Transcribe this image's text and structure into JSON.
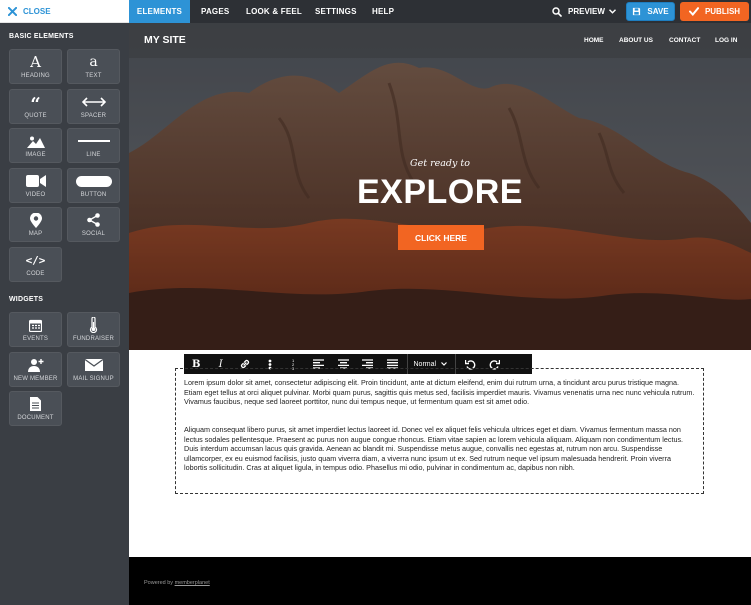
{
  "topbar": {
    "close_label": "CLOSE",
    "tabs": [
      {
        "label": "ELEMENTS"
      },
      {
        "label": "PAGES"
      },
      {
        "label": "LOOK & FEEL"
      },
      {
        "label": "SETTINGS"
      },
      {
        "label": "HELP"
      }
    ],
    "preview_label": "PREVIEW",
    "save_label": "SAVE",
    "publish_label": "PUBLISH"
  },
  "sidebar": {
    "basic_label": "BASIC ELEMENTS",
    "basic": [
      {
        "label": "HEADING",
        "icon": "heading-icon"
      },
      {
        "label": "TEXT",
        "icon": "text-icon"
      },
      {
        "label": "QUOTE",
        "icon": "quote-icon"
      },
      {
        "label": "SPACER",
        "icon": "spacer-icon"
      },
      {
        "label": "IMAGE",
        "icon": "image-icon"
      },
      {
        "label": "LINE",
        "icon": "line-icon"
      },
      {
        "label": "VIDEO",
        "icon": "video-icon"
      },
      {
        "label": "BUTTON",
        "icon": "button-icon"
      },
      {
        "label": "MAP",
        "icon": "map-pin-icon"
      },
      {
        "label": "SOCIAL",
        "icon": "share-icon"
      },
      {
        "label": "CODE",
        "icon": "code-icon"
      }
    ],
    "widgets_label": "WIDGETS",
    "widgets": [
      {
        "label": "EVENTS",
        "icon": "calendar-icon"
      },
      {
        "label": "FUNDRAISER",
        "icon": "thermometer-icon"
      },
      {
        "label": "NEW MEMBER",
        "icon": "add-user-icon"
      },
      {
        "label": "MAIL SIGNUP",
        "icon": "envelope-icon"
      },
      {
        "label": "DOCUMENT",
        "icon": "document-icon"
      }
    ]
  },
  "site": {
    "name": "MY SITE",
    "nav": [
      {
        "label": "HOME"
      },
      {
        "label": "ABOUT US"
      },
      {
        "label": "CONTACT"
      },
      {
        "label": "LOG IN"
      }
    ],
    "tagline": "Get ready to",
    "headline": "EXPLORE",
    "cta_label": "CLICK HERE"
  },
  "editor": {
    "format_value": "Normal",
    "paragraph1": "Lorem ipsum dolor sit amet, consectetur adipiscing elit. Proin tincidunt, ante at dictum eleifend, enim dui rutrum urna, a tincidunt arcu purus tristique magna. Etiam eget tellus at orci aliquet pulvinar. Morbi quam purus, sagittis quis metus sed, facilisis imperdiet mauris. Vivamus venenatis urna nec nunc vehicula rutrum. Vivamus faucibus, neque sed laoreet porttitor, nunc dui tempus neque, ut fermentum quam est sit amet odio.",
    "paragraph2": "Aliquam consequat libero purus, sit amet imperdiet lectus laoreet id. Donec vel ex aliquet felis vehicula ultrices eget et diam. Vivamus fermentum massa non lectus sodales pellentesque. Praesent ac purus non augue congue rhoncus. Etiam vitae sapien ac lorem vehicula aliquam. Aliquam non condimentum lectus. Duis interdum accumsan lacus quis gravida. Aenean ac blandit mi. Suspendisse metus augue, convallis nec egestas at, rutrum non arcu. Suspendisse ullamcorper, ex eu euismod facilisis, justo quam viverra diam, a viverra nunc ipsum ut ex. Sed rutrum neque vel ipsum malesuada hendrerit. Proin viverra lobortis sollicitudin. Cras at aliquet ligula, in tempus odio. Phasellus mi odio, pulvinar in condimentum ac, dapibus non nibh."
  },
  "footer": {
    "powered_prefix": "Powered by ",
    "powered_link": "memberplanet"
  },
  "colors": {
    "accent": "#2d93d6",
    "publish": "#f26522",
    "sidebar": "#3a3e44",
    "topbar": "#2d3035"
  }
}
